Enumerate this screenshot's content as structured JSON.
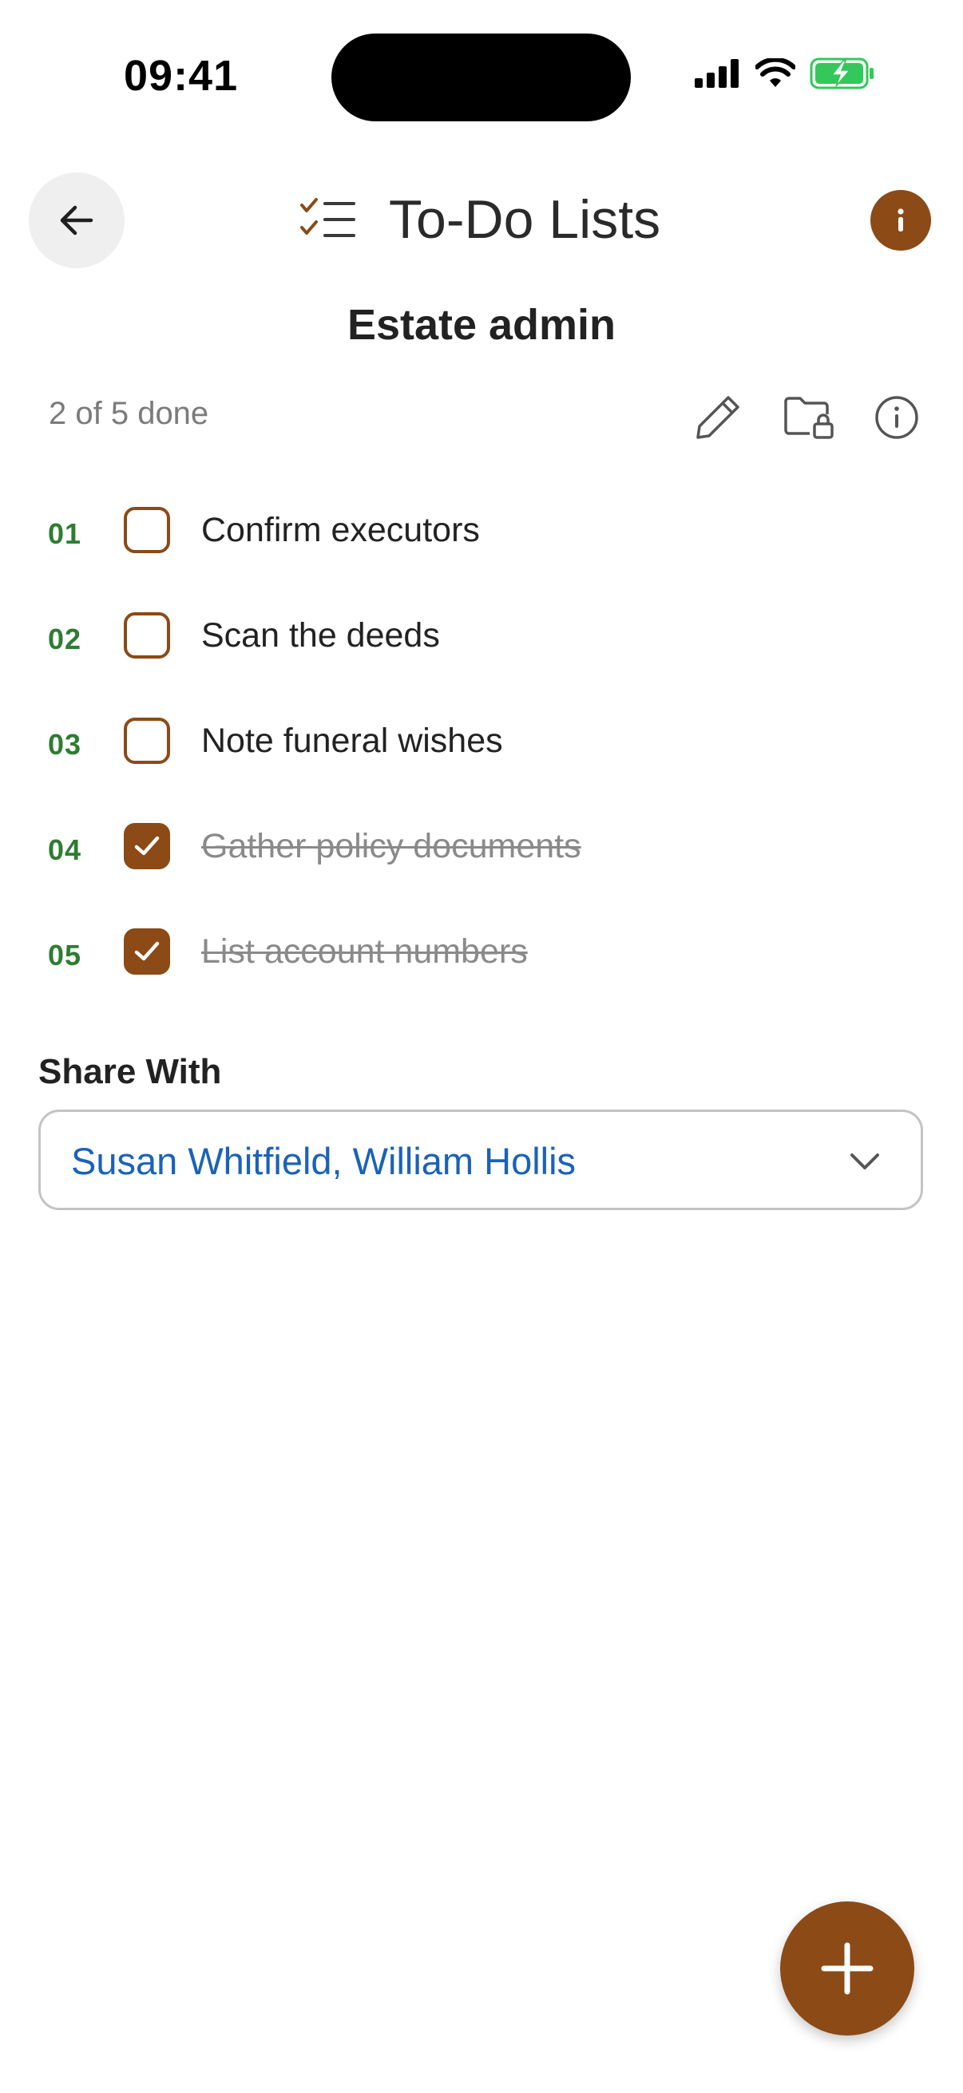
{
  "status_bar": {
    "time": "09:41"
  },
  "header": {
    "app_title": "To-Do Lists"
  },
  "list": {
    "title": "Estate admin",
    "progress": "2 of 5 done",
    "tasks": [
      {
        "number": "01",
        "text": "Confirm executors",
        "done": false
      },
      {
        "number": "02",
        "text": "Scan the deeds",
        "done": false
      },
      {
        "number": "03",
        "text": "Note funeral wishes",
        "done": false
      },
      {
        "number": "04",
        "text": "Gather policy documents",
        "done": true
      },
      {
        "number": "05",
        "text": "List account numbers",
        "done": true
      }
    ]
  },
  "share": {
    "label": "Share With",
    "value": "Susan Whitfield, William Hollis"
  },
  "icons": {
    "back": "arrow-left-icon",
    "list": "checklist-icon",
    "info": "info-icon",
    "edit": "pencil-icon",
    "folder": "folder-lock-icon",
    "details": "info-circle-icon",
    "add": "plus-icon"
  },
  "colors": {
    "accent": "#8b4a16",
    "number_green": "#2e7d32",
    "link_blue": "#1a62b9",
    "battery_green": "#34c759"
  }
}
